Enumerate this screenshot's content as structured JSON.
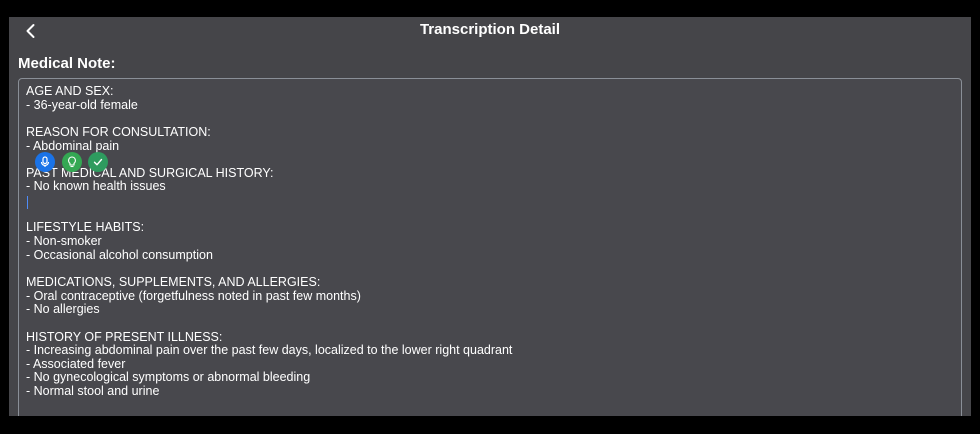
{
  "header": {
    "title": "Transcription Detail",
    "back_icon": "chevron-left-icon"
  },
  "note_section": {
    "label": "Medical Note:"
  },
  "note": {
    "lines": [
      "AGE AND SEX:",
      "- 36-year-old female",
      "",
      "REASON FOR CONSULTATION:",
      "- Abdominal pain",
      "",
      "PAST MEDICAL AND SURGICAL HISTORY:",
      "- No known health issues",
      "",
      "",
      "LIFESTYLE HABITS:",
      "- Non-smoker",
      "- Occasional alcohol consumption",
      "",
      "MEDICATIONS, SUPPLEMENTS, AND ALLERGIES:",
      "- Oral contraceptive (forgetfulness noted in past few months)",
      "- No allergies",
      "",
      "HISTORY OF PRESENT ILLNESS:",
      "- Increasing abdominal pain over the past few days, localized to the lower right quadrant",
      "- Associated fever",
      "- No gynecological symptoms or abnormal bleeding",
      "- Normal stool and urine"
    ]
  },
  "floating_tools": [
    {
      "name": "microphone-icon",
      "color": "#1a73e8"
    },
    {
      "name": "lightbulb-icon",
      "color": "#34a853"
    },
    {
      "name": "checkmark-icon",
      "color": "#2e9c5f"
    }
  ],
  "colors": {
    "background": "#454549",
    "frame": "#000000",
    "text": "#ffffff",
    "border": "#8a8f97"
  }
}
